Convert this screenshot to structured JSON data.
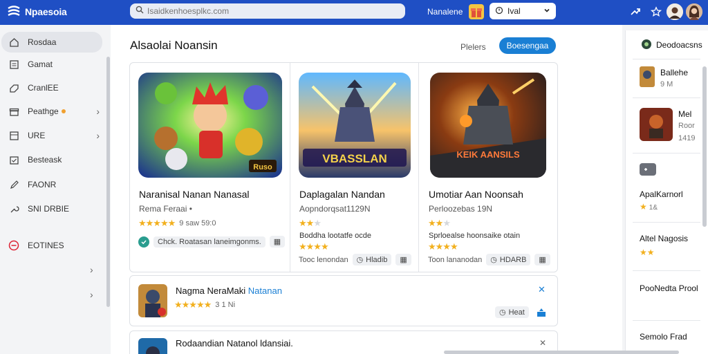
{
  "app": {
    "name": "Npaesoia"
  },
  "search": {
    "placeholder": "Isaidkenhoesplkc.com"
  },
  "topbar": {
    "link_label": "Nanalene",
    "lang_select": "Ival",
    "icons": [
      "trending-icon",
      "star-outline-icon",
      "profile-icon",
      "avatar-icon"
    ]
  },
  "sidebar": {
    "items": [
      {
        "label": "Rosdaa",
        "icon": "home-icon"
      },
      {
        "label": "Gamat",
        "icon": "list-icon"
      },
      {
        "label": "CranlEE",
        "icon": "share-icon"
      },
      {
        "label": "Peathge",
        "icon": "gift-icon"
      },
      {
        "label": "URE",
        "icon": "bookmark-icon"
      },
      {
        "label": "Besteask",
        "icon": "tasks-icon"
      },
      {
        "label": "FAONR",
        "icon": "pen-icon"
      },
      {
        "label": "SNI DRBIE",
        "icon": "wrench-icon"
      },
      {
        "label": "EOTINES",
        "icon": "circle-alert-icon"
      }
    ]
  },
  "main": {
    "title": "Alsaolai Noansin",
    "filter_label": "Plelers",
    "primary_button": "Boesengaa",
    "cards": [
      {
        "title": "Naranisal Nanan Nanasal",
        "subtitle": "Rema Feraai •",
        "rating_text": "9 saw 59:0",
        "rating": 5,
        "footer": "Chck. Roatasan laneimgonms.",
        "footer_badge": "verified-icon",
        "logo_text": "Ruso"
      },
      {
        "title": "Daplagalan Nandan",
        "subtitle": "Aopndorqsat1129N",
        "rating": 2,
        "note": "Boddha lootatfe ocde",
        "note_stars": 4,
        "footer_left": "Tooc lenondan",
        "footer_chip": "Hladib",
        "logo_text": "VBASSLAN"
      },
      {
        "title": "Umotiar Aan Noonsah",
        "subtitle": "Perloozebas 19N",
        "rating": 2,
        "note": "Sprloealse hoonsaike otain",
        "note_stars": 4,
        "footer_left": "Toon lananodan",
        "footer_chip": "HDARB",
        "logo_text": "KEIK AANSILS"
      }
    ],
    "rows": [
      {
        "title_main": "Nagma NeraMaki",
        "title_accent": "Natanan",
        "rating": 5,
        "rating_text": "3 1 Ni",
        "chip": "Heat"
      },
      {
        "title_main": "Rodaandian Natanol ldansiai.",
        "title_accent": ""
      }
    ]
  },
  "right_panel": {
    "header": "Deodoacsns",
    "items": [
      {
        "title": "Ballehe",
        "sub": "9 M"
      },
      {
        "title": "Mel",
        "sub": "Roor",
        "extra": "1419"
      },
      {
        "title": "ApalKarnorl",
        "stars": "★",
        "stars_text": "1&"
      },
      {
        "title": "Altel Nagosis",
        "stars": "★★"
      },
      {
        "title": "PooNedta Prool"
      },
      {
        "title": "Semolo Frad"
      }
    ]
  },
  "colors": {
    "brand": "#1f4fc4",
    "accent": "#1a7fd4",
    "star": "#f2b01e"
  }
}
